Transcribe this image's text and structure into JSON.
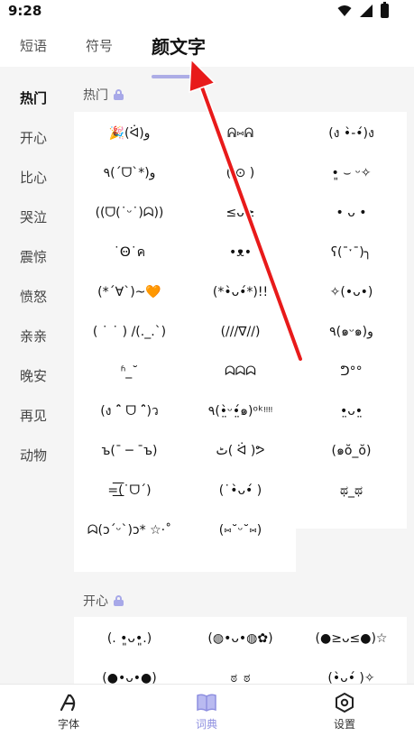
{
  "status": {
    "time": "9:28"
  },
  "top_tabs": [
    "短语",
    "符号",
    "颜文字"
  ],
  "side_nav": [
    "热门",
    "开心",
    "比心",
    "哭泣",
    "震惊",
    "愤怒",
    "亲亲",
    "晚安",
    "再见",
    "动物"
  ],
  "sections": [
    {
      "title": "热门",
      "items": [
        "🎉(ᐛ)و",
        "ᕱ⑅ᕱ",
        "(ง •̀-•́)ง",
        "٩(´ᗜ`*)و",
        "( ⊙ )",
        "•͈ ⌣ ᵕ✧",
        "((ᗜ(˙ᵕ˙)ᗣ))",
        "≤ᴗ≥",
        "• ᴗ •",
        "˙Ꙫ˙ค",
        "•ᴥ•",
        "ʕ(¯ˑ¯)╮",
        "(*´∀`)~🧡",
        "(*•̀ᴗ•́*)!!",
        "✧(•ᴗ•)",
        "( ˙ ˙ ) /(._.`)",
        "(///∇//)",
        "٩(๑ᵕ๑)و",
        "ʱ_˘",
        "ᗣᗣᗣ",
        "ᕤ°°",
        "(ง ˆ̑ ᗜ ˆ̑)ว",
        "٩(•̤̀ᵕ•̤́๑)ᵒᵏᵎᵎᵎᵎ",
        "•̤ᴗ•̤",
        "ъ(¯ ─ ¯ъ)",
        "ٹ( ᐛ )ᕗ",
        "(๑ŏ_ŏ)",
        "=͟͟͞͞(˙ᗜ´)",
        "(˙•̀ᴗ•́ )",
        "ಥ_ಥ",
        "ᗣ(ɔ´ᵕ`)ɔ* ☆·˚",
        "(⑅˘ᵕ˘⑅)"
      ]
    },
    {
      "title": "开心",
      "items": [
        "(. •͈ᴗ•͈.)",
        "(◍•ᴗ•◍✿)",
        "(●≥ᴗ≤●)☆",
        "(●•ᴗ•●)",
        "ಠ_ಠ",
        "(•̀ᴗ•́ )✧"
      ]
    }
  ],
  "bottom_nav": [
    "字体",
    "词典",
    "设置"
  ],
  "colors": {
    "accent": "#8e8fe0",
    "arrow": "#e81a1a"
  }
}
